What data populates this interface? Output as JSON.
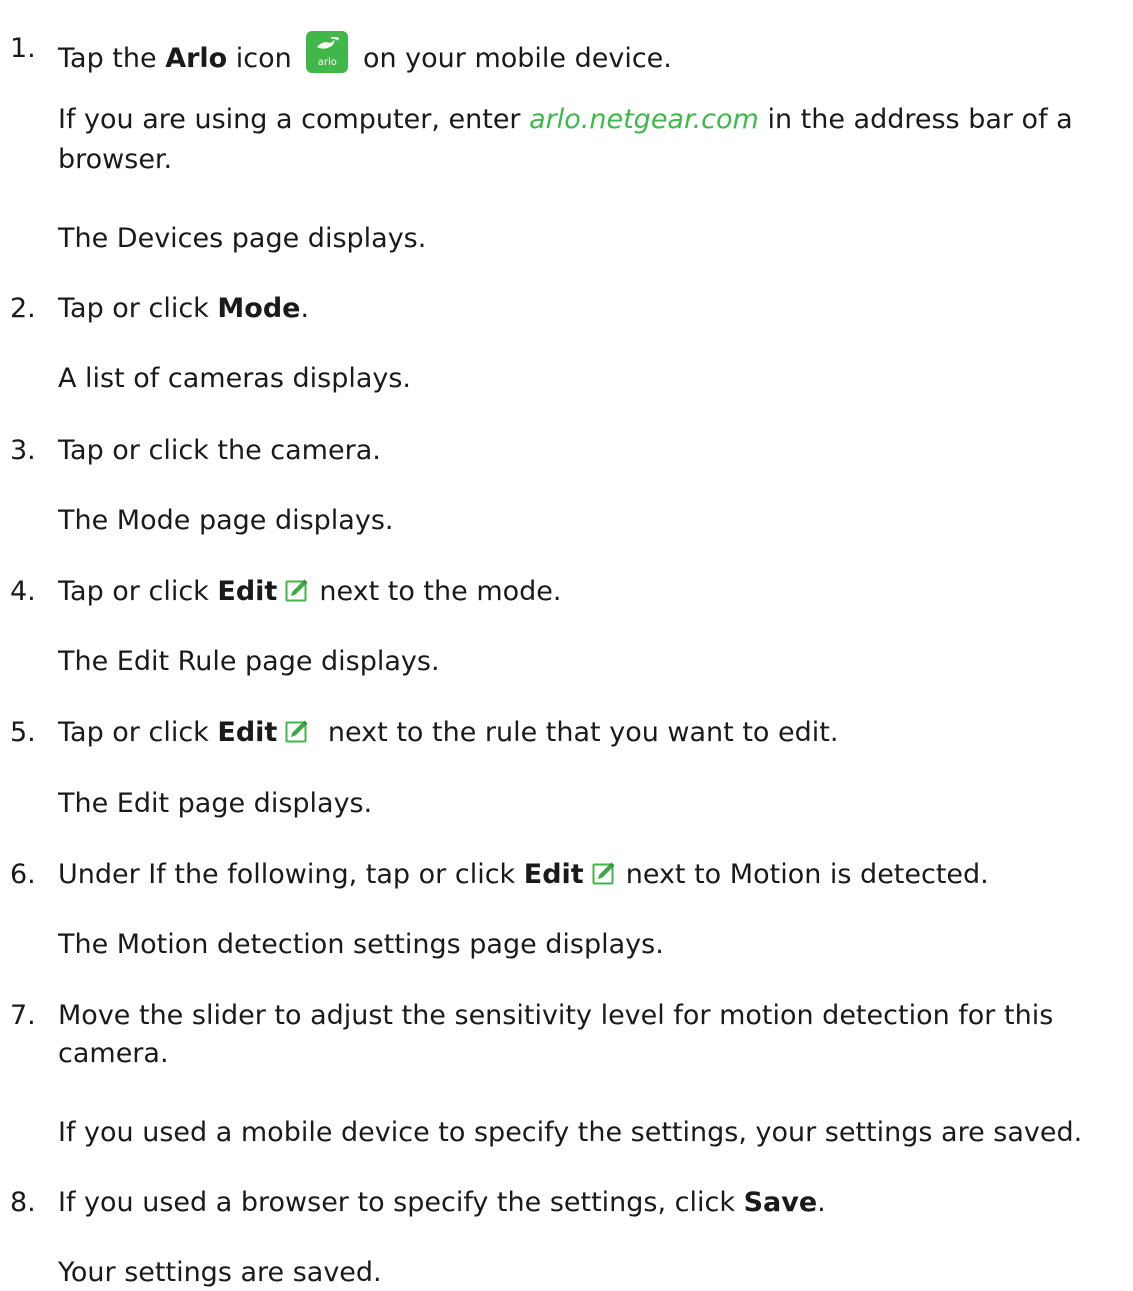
{
  "steps": [
    {
      "number": "1.",
      "line1_pre": "Tap the ",
      "line1_bold": "Arlo",
      "line1_mid": " icon ",
      "icon_word": "arlo",
      "line1_post": " on your mobile device.",
      "p1_pre": "If you are using a computer, enter ",
      "p1_link": "arlo.netgear.com",
      "p1_post": " in the address bar of a",
      "p1_line2": "browser.",
      "p2": "The Devices page displays."
    },
    {
      "number": "2.",
      "pre": "Tap or click ",
      "bold": "Mode",
      "post": ".",
      "result": "A list of cameras displays."
    },
    {
      "number": "3.",
      "text": "Tap or click the camera.",
      "result": "The Mode page displays."
    },
    {
      "number": "4.",
      "pre": "Tap or click ",
      "bold": "Edit",
      "post": "next to the mode.",
      "result": "The Edit Rule page displays."
    },
    {
      "number": "5.",
      "pre": "Tap or click ",
      "bold": "Edit",
      "post": " next to the rule that you want to edit.",
      "result": "The Edit page displays."
    },
    {
      "number": "6.",
      "pre": "Under If the following, tap or click ",
      "bold": "Edit",
      "post": "next to Motion is detected.",
      "result": "The Motion detection settings page displays."
    },
    {
      "number": "7.",
      "text": "Move the slider to adjust the sensitivity level for motion detection for this",
      "text_line2": "camera.",
      "result": "If you used a mobile device to specify the settings, your settings are saved."
    },
    {
      "number": "8.",
      "pre": "If you used a browser to specify the settings, click ",
      "bold": "Save",
      "post": ".",
      "result": "Your settings are saved."
    }
  ],
  "colors": {
    "text": "#1a1a1a",
    "link": "#3dbb4a",
    "arlo_icon_bg": "#41b649",
    "edit_icon_frame": "#41b649"
  },
  "icons": [
    "arlo-app-icon",
    "edit-icon"
  ]
}
